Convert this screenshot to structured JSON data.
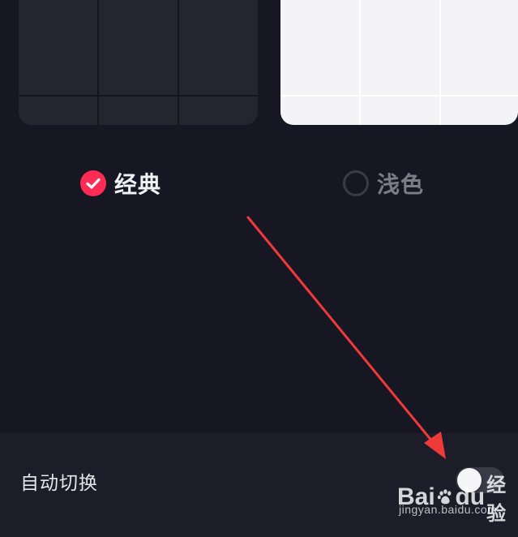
{
  "themes": {
    "classic": {
      "label": "经典",
      "selected": true
    },
    "light": {
      "label": "浅色",
      "selected": false
    }
  },
  "settings": {
    "auto_switch": {
      "label": "自动切换",
      "enabled": false
    }
  },
  "watermark": {
    "brand_prefix": "Bai",
    "brand_mid": "du",
    "brand_suffix": "经验",
    "url": "jingyan.baidu.com"
  },
  "colors": {
    "accent": "#fe2c55",
    "background": "#161722",
    "row_background": "#1c1d28",
    "arrow": "#f03a3a"
  }
}
